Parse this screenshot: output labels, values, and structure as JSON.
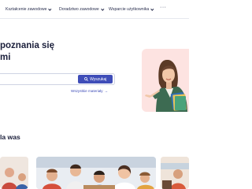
{
  "nav": {
    "items": [
      {
        "label": "Kształcenie zawodowe"
      },
      {
        "label": "Doradztwo zawodowe"
      },
      {
        "label": "Wsparcie użytkownika"
      }
    ],
    "more_label": "···"
  },
  "hero": {
    "title_line1": "poznania się",
    "title_line2": "mi",
    "search_placeholder": "",
    "search_button_label": "Wyszukaj",
    "all_materials_label": "Wszystkie materiały",
    "all_materials_arrow": "→"
  },
  "section": {
    "title": "la was"
  },
  "icons": {
    "chevron": "chevron-down-icon",
    "search": "search-icon",
    "arrow": "arrow-right-icon"
  },
  "colors": {
    "accent": "#3f4db8",
    "hero_panel": "#fde3e1",
    "text": "#1b1f3b"
  }
}
